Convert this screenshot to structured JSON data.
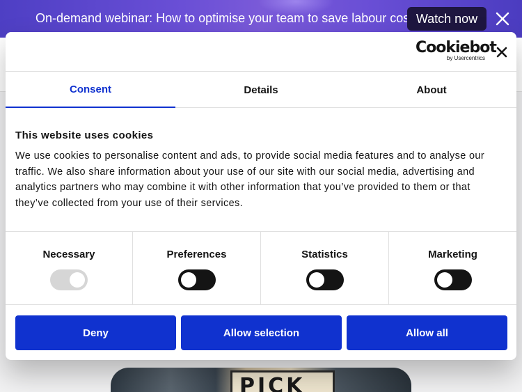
{
  "banner": {
    "text": "On-demand webinar: How to optimise your team to save labour costs",
    "cta_label": "Watch now",
    "close_icon": "close-icon"
  },
  "background": {
    "photo_sign_text": "PICK UP"
  },
  "modal": {
    "logo": {
      "name": "Cookiebot",
      "byline": "by Usercentrics"
    },
    "close_icon": "close-icon",
    "tabs": [
      {
        "label": "Consent",
        "active": true
      },
      {
        "label": "Details",
        "active": false
      },
      {
        "label": "About",
        "active": false
      }
    ],
    "title": "This website uses cookies",
    "description": "We use cookies to personalise content and ads, to provide social media features and to analyse our traffic. We also share information about your use of our site with our social media, advertising and analytics partners who may combine it with other information that you’ve provided to them or that they’ve collected from your use of their services.",
    "categories": [
      {
        "label": "Necessary",
        "enabled": true,
        "locked": true
      },
      {
        "label": "Preferences",
        "enabled": false,
        "locked": false
      },
      {
        "label": "Statistics",
        "enabled": false,
        "locked": false
      },
      {
        "label": "Marketing",
        "enabled": false,
        "locked": false
      }
    ],
    "buttons": {
      "deny": "Deny",
      "allow_selection": "Allow selection",
      "allow_all": "Allow all"
    }
  },
  "colors": {
    "primary": "#1032cf",
    "text": "#141414",
    "banner_button": "#1e1640"
  }
}
